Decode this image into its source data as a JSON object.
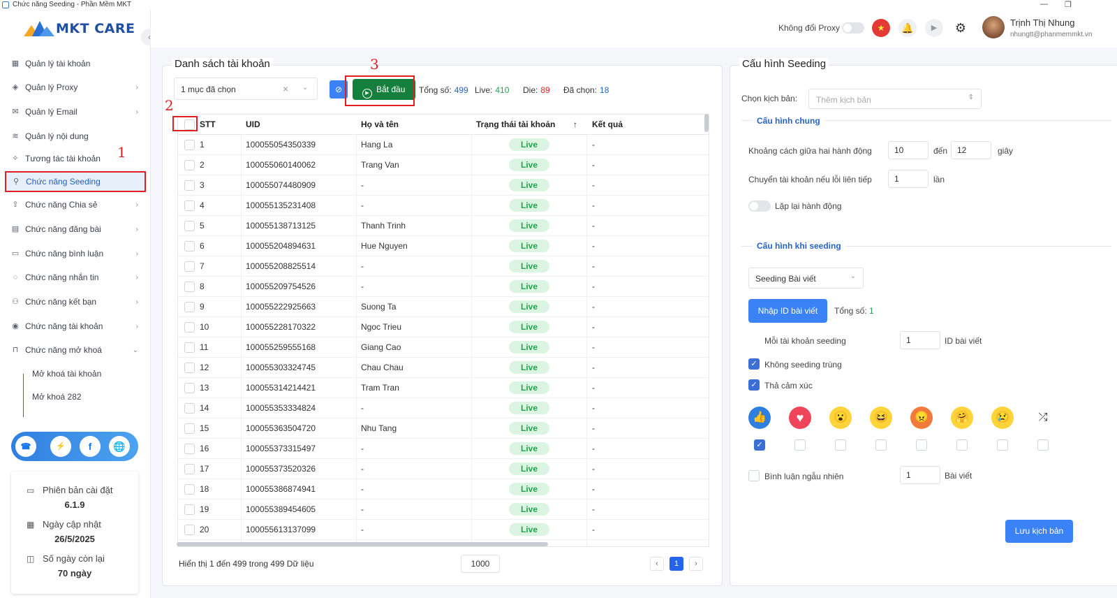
{
  "window": {
    "title": "Chức năng Seeding - Phần Mềm MKT"
  },
  "brand": {
    "logo_text": "MKT CARE"
  },
  "sidebar": {
    "items": [
      {
        "label": "Quản lý tài khoản",
        "icon": "grid-icon",
        "chevron": false
      },
      {
        "label": "Quản lý Proxy",
        "icon": "layers-icon",
        "chevron": true
      },
      {
        "label": "Quản lý Email",
        "icon": "mail-icon",
        "chevron": true
      },
      {
        "label": "Quản lý nội dung",
        "icon": "content-icon",
        "chevron": false
      },
      {
        "label": "Tương tác tài khoản",
        "icon": "interact-icon",
        "chevron": false
      },
      {
        "label": "Chức năng Seeding",
        "icon": "seeding-icon",
        "chevron": false,
        "active": true
      },
      {
        "label": "Chức năng Chia sẻ",
        "icon": "share-icon",
        "chevron": true
      },
      {
        "label": "Chức năng đăng bài",
        "icon": "post-icon",
        "chevron": true
      },
      {
        "label": "Chức năng bình luận",
        "icon": "comment-icon",
        "chevron": true
      },
      {
        "label": "Chức năng nhắn tin",
        "icon": "message-icon",
        "chevron": true
      },
      {
        "label": "Chức năng kết bạn",
        "icon": "add-friend-icon",
        "chevron": true
      },
      {
        "label": "Chức năng tài khoản",
        "icon": "account-icon",
        "chevron": true
      },
      {
        "label": "Chức năng mở khoá",
        "icon": "lock-icon",
        "chevron": true,
        "expanded": true
      }
    ],
    "sub_items": [
      "Mở khoá tài khoản",
      "Mở khoá 282"
    ],
    "social": [
      "support-icon",
      "messenger-icon",
      "facebook-icon",
      "globe-icon"
    ],
    "version": {
      "install_label": "Phiên bản cài đặt",
      "install_value": "6.1.9",
      "update_label": "Ngày cập nhật",
      "update_value": "26/5/2025",
      "remain_label": "Số ngày còn lại",
      "remain_value": "70 ngày"
    }
  },
  "header": {
    "proxy_label": "Không đổi Proxy",
    "user_name": "Trịnh Thị Nhung",
    "user_email": "nhungtt@phanmemmkt.vn"
  },
  "accounts": {
    "title": "Danh sách tài khoản",
    "filter_value": "1 mục đã chọn",
    "start_label": "Bắt đầu",
    "stats": {
      "total_label": "Tổng số:",
      "total": "499",
      "live_label": "Live:",
      "live": "410",
      "die_label": "Die:",
      "die": "89",
      "selected_label": "Đã chọn:",
      "selected": "18"
    },
    "columns": [
      "STT",
      "UID",
      "Họ và tên",
      "Trạng thái tài khoản",
      "Kết quả"
    ],
    "rows": [
      [
        "1",
        "100055054350339",
        "Hang La",
        "Live",
        "-"
      ],
      [
        "2",
        "100055060140062",
        "Trang Van",
        "Live",
        "-"
      ],
      [
        "3",
        "100055074480909",
        "-",
        "Live",
        "-"
      ],
      [
        "4",
        "100055135231408",
        "-",
        "Live",
        "-"
      ],
      [
        "5",
        "100055138713125",
        "Thanh Trinh",
        "Live",
        "-"
      ],
      [
        "6",
        "100055204894631",
        "Hue Nguyen",
        "Live",
        "-"
      ],
      [
        "7",
        "100055208825514",
        "-",
        "Live",
        "-"
      ],
      [
        "8",
        "100055209754526",
        "-",
        "Live",
        "-"
      ],
      [
        "9",
        "100055222925663",
        "Suong Ta",
        "Live",
        "-"
      ],
      [
        "10",
        "100055228170322",
        "Ngoc Trieu",
        "Live",
        "-"
      ],
      [
        "11",
        "100055259555168",
        "Giang Cao",
        "Live",
        "-"
      ],
      [
        "12",
        "100055303324745",
        "Chau Chau",
        "Live",
        "-"
      ],
      [
        "13",
        "100055314214421",
        "Tram Tran",
        "Live",
        "-"
      ],
      [
        "14",
        "100055353334824",
        "-",
        "Live",
        "-"
      ],
      [
        "15",
        "100055363504720",
        "Nhu Tang",
        "Live",
        "-"
      ],
      [
        "16",
        "100055373315497",
        "-",
        "Live",
        "-"
      ],
      [
        "17",
        "100055373520326",
        "-",
        "Live",
        "-"
      ],
      [
        "18",
        "100055386874941",
        "-",
        "Live",
        "-"
      ],
      [
        "19",
        "100055389454605",
        "-",
        "Live",
        "-"
      ],
      [
        "20",
        "100055613137099",
        "-",
        "Live",
        "-"
      ]
    ],
    "footer_text": "Hiển thị 1 đến 499 trong 499 Dữ liệu",
    "page_size": "1000",
    "current_page": "1",
    "annotations": [
      "1",
      "2",
      "3"
    ]
  },
  "config": {
    "title": "Cấu hình Seeding",
    "script_label": "Chọn kịch bản:",
    "script_placeholder": "Thêm kịch bản",
    "general_title": "Cấu hình chung",
    "gap_label": "Khoảng cách giữa hai hành động",
    "gap_from": "10",
    "to_label": "đến",
    "gap_to": "12",
    "seconds_label": "giây",
    "switch_label": "Chuyển tài khoản nếu lỗi liên tiếp",
    "switch_value": "1",
    "times_label": "lần",
    "repeat_label": "Lặp lại hành động",
    "seeding_title": "Cấu hình khi seeding",
    "seeding_type": "Seeding Bài viết",
    "import_label": "Nhập ID bài viết",
    "total_label": "Tổng số:",
    "total_value": "1",
    "per_account_label": "Mỗi tài khoản seeding",
    "per_account_value": "1",
    "per_account_unit": "ID bài viết",
    "no_dup_label": "Không seeding trùng",
    "react_label": "Thả cảm xúc",
    "reactions": [
      {
        "name": "like-reaction-icon",
        "glyph": "👍",
        "bg": "#2f7fe0",
        "checked": true
      },
      {
        "name": "love-reaction-icon",
        "glyph": "♥",
        "bg": "#f0445a",
        "checked": false
      },
      {
        "name": "wow-reaction-icon",
        "glyph": "😮",
        "bg": "#ffd43b",
        "checked": false
      },
      {
        "name": "haha-reaction-icon",
        "glyph": "😆",
        "bg": "#ffd43b",
        "checked": false
      },
      {
        "name": "angry-reaction-icon",
        "glyph": "😠",
        "bg": "#f27a3a",
        "checked": false
      },
      {
        "name": "care-reaction-icon",
        "glyph": "🤗",
        "bg": "#ffd43b",
        "checked": false
      },
      {
        "name": "sad-reaction-icon",
        "glyph": "😢",
        "bg": "#ffd43b",
        "checked": false
      },
      {
        "name": "random-reaction-icon",
        "glyph": "⤮",
        "bg": "#ffffff",
        "checked": false
      }
    ],
    "random_comment_label": "Bình luận ngẫu nhiên",
    "random_comment_value": "1",
    "random_comment_unit": "Bài viết",
    "save_label": "Lưu kịch bản"
  },
  "colors": {
    "accent": "#3b82f6",
    "start": "#15803d",
    "live": "#22a34d",
    "annotation": "#e02020"
  }
}
